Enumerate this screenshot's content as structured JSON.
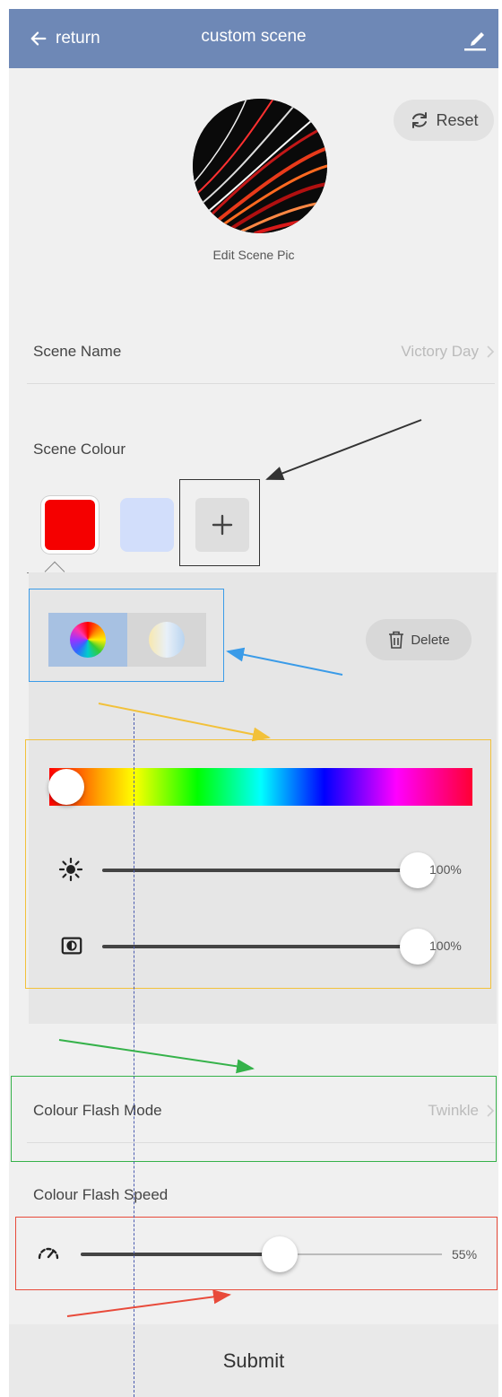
{
  "header": {
    "back_label": "return",
    "title": "custom scene"
  },
  "scene": {
    "reset_label": "Reset",
    "edit_pic_label": "Edit Scene Pic",
    "name_label": "Scene Name",
    "name_value": "Victory Day",
    "colour_label": "Scene Colour"
  },
  "colours": {
    "swatches": [
      "#f50000",
      "#d2defb"
    ],
    "delete_label": "Delete",
    "hue_position": 0,
    "brightness_pct": 100,
    "brightness_label": "100%",
    "saturation_pct": 100,
    "saturation_label": "100%"
  },
  "flash": {
    "mode_label": "Colour Flash Mode",
    "mode_value": "Twinkle",
    "speed_label": "Colour Flash Speed",
    "speed_pct": 55,
    "speed_value_label": "55%"
  },
  "submit_label": "Submit",
  "colors": {
    "header_bg": "#6e88b6",
    "annotation_black": "#333333",
    "annotation_blue": "#3a9be8",
    "annotation_yellow": "#f2c13a",
    "annotation_green": "#35b24a",
    "annotation_red": "#e84a3a"
  }
}
